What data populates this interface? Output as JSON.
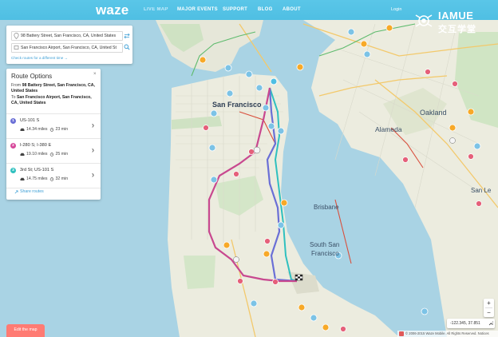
{
  "nav": {
    "logo": "waze",
    "links": [
      "LIVE MAP",
      "MAJOR EVENTS",
      "SUPPORT",
      "BLOG",
      "ABOUT"
    ],
    "login": "Login"
  },
  "watermark": {
    "en": "IAMUE",
    "cn": "交互学堂"
  },
  "search": {
    "from_value": "98 Battery Street, San Francisco, CA, United States",
    "to_value": "San Francisco Airport, San Francisco, CA, United St",
    "check_routes": "Check routes for a different time  →",
    "swap_icon": "swap-icon",
    "search_icon": "search-icon"
  },
  "routes": {
    "title": "Route Options",
    "close": "×",
    "from_prefix": "From",
    "from_text": "98 Battery Street, San Francisco, CA, United States",
    "to_prefix": "To",
    "to_text": "San Francisco Airport, San Francisco, CA, United States",
    "items": [
      {
        "num": "1",
        "name": "US-101 S",
        "distance": "14.34 miles",
        "time": "23 min",
        "color": "#6a6fd6"
      },
      {
        "num": "2",
        "name": "I-280 S; I-380 E",
        "distance": "19.10 miles",
        "time": "25 min",
        "color": "#d6479a"
      },
      {
        "num": "3",
        "name": "3rd St; US-101 S",
        "distance": "14.75 miles",
        "time": "32 min",
        "color": "#2fc0bf"
      }
    ],
    "share": "Share routes"
  },
  "edit_map": "Edit the map",
  "zoom": {
    "in": "+",
    "out": "−"
  },
  "coords": "-122.345, 37.851",
  "footer": "© 2006-2015 Waze Mobile. All Rights Reserved. Notices",
  "map": {
    "labels": {
      "san_francisco": "San Francisco",
      "alameda": "Alameda",
      "oakland": "Oakland",
      "brisbane": "Brisbane",
      "south_sf_1": "South San",
      "south_sf_2": "Francisco",
      "san_leandro": "San Le"
    },
    "colors": {
      "water": "#a9d3e4",
      "land": "#ececdf",
      "park": "#cfe6c4",
      "route_1": "#6a6fd6",
      "route_2": "#c8488f",
      "route_3": "#2fc0bf"
    }
  }
}
